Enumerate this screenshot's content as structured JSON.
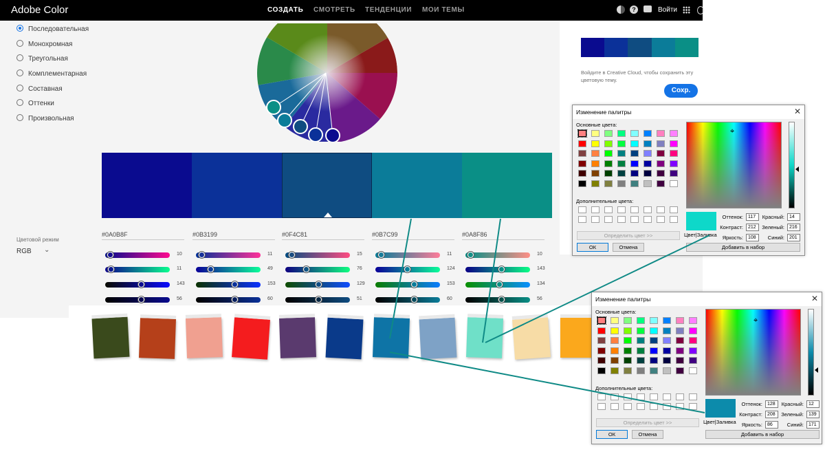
{
  "app": {
    "brand": "Adobe Color",
    "nav": [
      "СОЗДАТЬ",
      "СМОТРЕТЬ",
      "ТЕНДЕНЦИИ",
      "МОИ ТЕМЫ"
    ],
    "active_nav": "СОЗДАТЬ",
    "signin": "Войти",
    "top_icons": [
      "color-blind-icon",
      "help-icon",
      "chat-icon",
      "apps-grid-icon"
    ]
  },
  "harmony_rules": [
    {
      "label": "Последовательная",
      "selected": true
    },
    {
      "label": "Монохромная",
      "selected": false
    },
    {
      "label": "Треугольная",
      "selected": false
    },
    {
      "label": "Комплементарная",
      "selected": false
    },
    {
      "label": "Составная",
      "selected": false
    },
    {
      "label": "Оттенки",
      "selected": false
    },
    {
      "label": "Произвольная",
      "selected": false
    }
  ],
  "color_mode": {
    "label": "Цветовой режим",
    "value": "RGB"
  },
  "swatches": [
    {
      "hex": "#0A0B8F",
      "color": "#0A0B8F",
      "rgb": [
        10,
        11,
        143,
        56
      ]
    },
    {
      "hex": "#0B3199",
      "color": "#0B3199",
      "rgb": [
        11,
        49,
        153,
        60
      ]
    },
    {
      "hex": "#0F4C81",
      "color": "#0F4C81",
      "rgb": [
        15,
        76,
        129,
        51
      ]
    },
    {
      "hex": "#0B7C99",
      "color": "#0B7C99",
      "rgb": [
        11,
        124,
        153,
        60
      ]
    },
    {
      "hex": "#0A8F86",
      "color": "#0A8F86",
      "rgb": [
        10,
        143,
        134,
        56
      ]
    }
  ],
  "save_panel": {
    "note": "Войдите в Creative Cloud, чтобы сохранить эту цветовую тему.",
    "save_label": "Сохр."
  },
  "fabrics": [
    "#3a4a1c",
    "#b5401a",
    "#f0a090",
    "#f41c1e",
    "#5a3a6e",
    "#0a3a8a",
    "#0e74a6",
    "#7ea2c6",
    "#6fe0c8",
    "#f7dca6",
    "#fba81c"
  ],
  "dialogs": [
    {
      "title": "Изменение палитры",
      "basic_label": "Основные цвета:",
      "custom_label": "Дополнительные цвета:",
      "define_label": "Определить цвет >>",
      "ok_label": "ОК",
      "cancel_label": "Отмена",
      "add_label": "Добавить в набор",
      "color_fill_label": "Цвет|Заливка",
      "hue_label": "Оттенок:",
      "hue": "117",
      "sat_label": "Контраст:",
      "sat": "212",
      "lum_label": "Яркость:",
      "lum": "108",
      "red_label": "Красный:",
      "red": "14",
      "green_label": "Зеленый:",
      "green": "216",
      "blue_label": "Синий:",
      "blue": "201",
      "current_color": "#0ed8c9"
    },
    {
      "title": "Изменение палитры",
      "basic_label": "Основные цвета:",
      "custom_label": "Дополнительные цвета:",
      "define_label": "Определить цвет >>",
      "ok_label": "ОК",
      "cancel_label": "Отмена",
      "add_label": "Добавить в набор",
      "color_fill_label": "Цвет|Заливка",
      "hue_label": "Оттенок:",
      "hue": "128",
      "sat_label": "Контраст:",
      "sat": "208",
      "lum_label": "Яркость:",
      "lum": "86",
      "red_label": "Красный:",
      "red": "12",
      "green_label": "Зеленый:",
      "green": "139",
      "blue_label": "Синий:",
      "blue": "171",
      "current_color": "#0c8bab"
    }
  ],
  "basic_colors": [
    "#ff8080",
    "#ffff80",
    "#80ff80",
    "#00ff80",
    "#80ffff",
    "#0080ff",
    "#ff80c0",
    "#ff80ff",
    "#ff0000",
    "#ffff00",
    "#80ff00",
    "#00ff40",
    "#00ffff",
    "#0080c0",
    "#8080c0",
    "#ff00ff",
    "#804040",
    "#ff8040",
    "#00ff00",
    "#008080",
    "#004080",
    "#8080ff",
    "#800040",
    "#ff0080",
    "#800000",
    "#ff8000",
    "#008000",
    "#008040",
    "#0000ff",
    "#0000a0",
    "#800080",
    "#8000ff",
    "#400000",
    "#804000",
    "#004000",
    "#004040",
    "#000080",
    "#000040",
    "#400040",
    "#400080",
    "#000000",
    "#808000",
    "#808040",
    "#808080",
    "#408080",
    "#c0c0c0",
    "#400040",
    "#ffffff"
  ]
}
